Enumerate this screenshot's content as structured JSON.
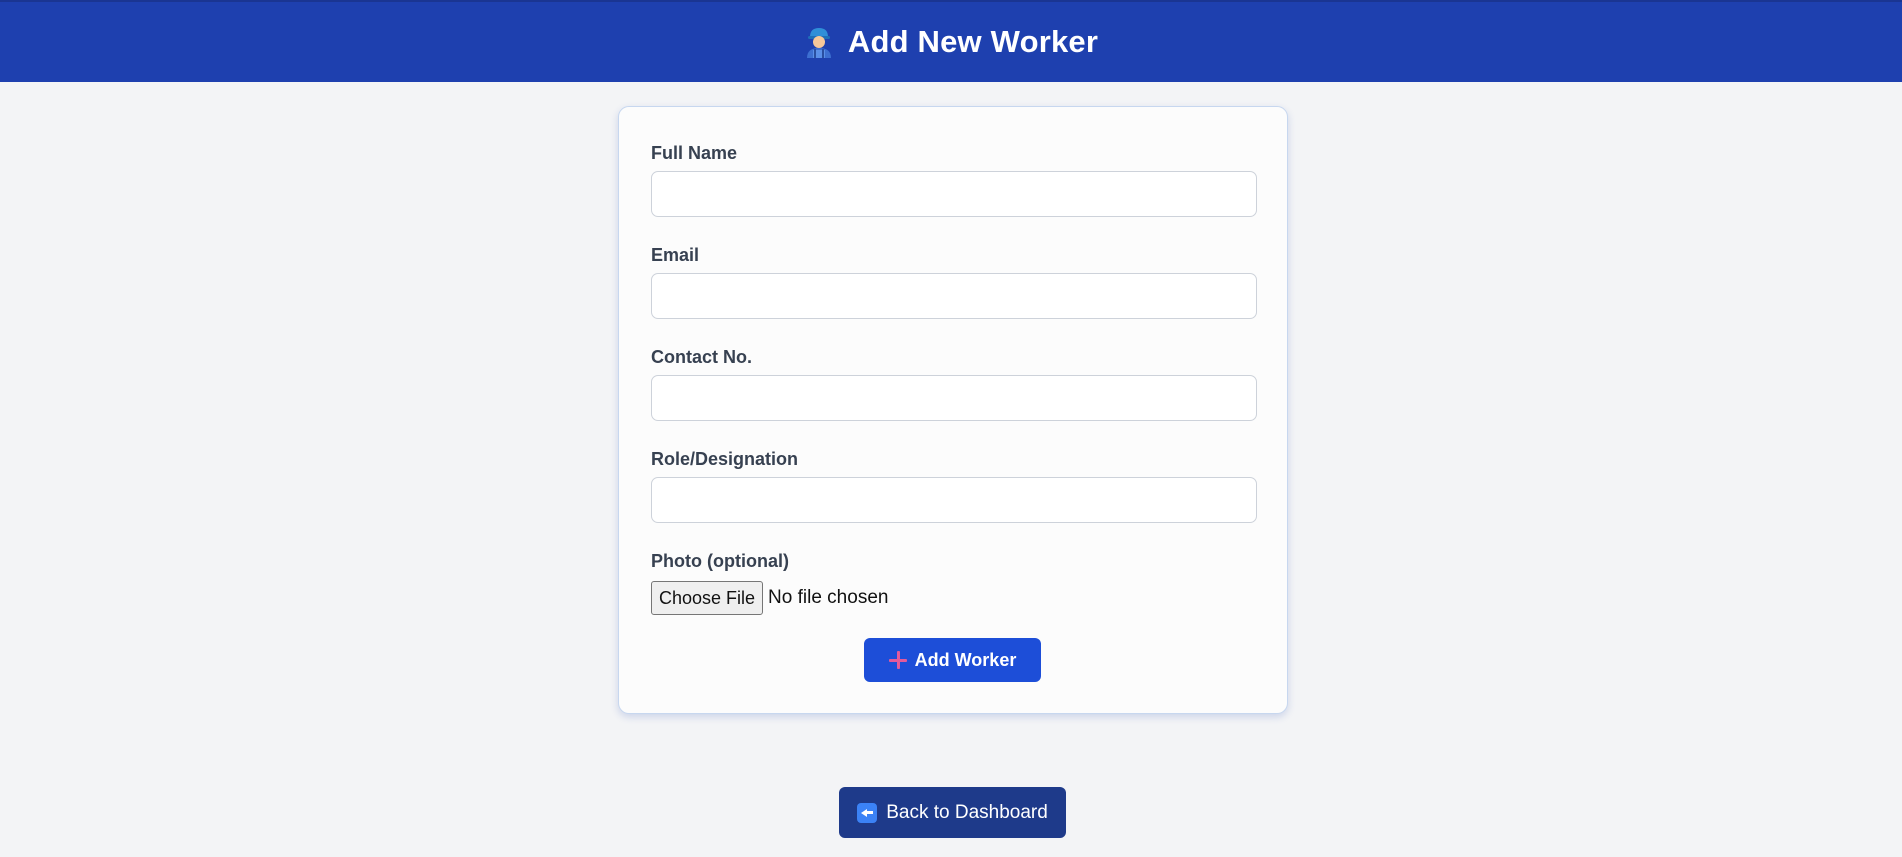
{
  "header": {
    "icon": "worker-icon",
    "title": "Add New Worker"
  },
  "form": {
    "fields": [
      {
        "label": "Full Name",
        "value": "",
        "placeholder": ""
      },
      {
        "label": "Email",
        "value": "",
        "placeholder": ""
      },
      {
        "label": "Contact No.",
        "value": "",
        "placeholder": ""
      },
      {
        "label": "Role/Designation",
        "value": "",
        "placeholder": ""
      }
    ],
    "photo": {
      "label": "Photo (optional)",
      "button_label": "Choose File",
      "status": "No file chosen"
    },
    "submit": {
      "icon": "plus-icon",
      "label": "Add Worker"
    }
  },
  "back": {
    "icon": "back-arrow-icon",
    "label": "Back to Dashboard"
  },
  "colors": {
    "header_bg": "#1e40af",
    "page_bg": "#f3f4f6",
    "primary_button": "#1d4ed8",
    "back_button": "#1e3a8a"
  }
}
